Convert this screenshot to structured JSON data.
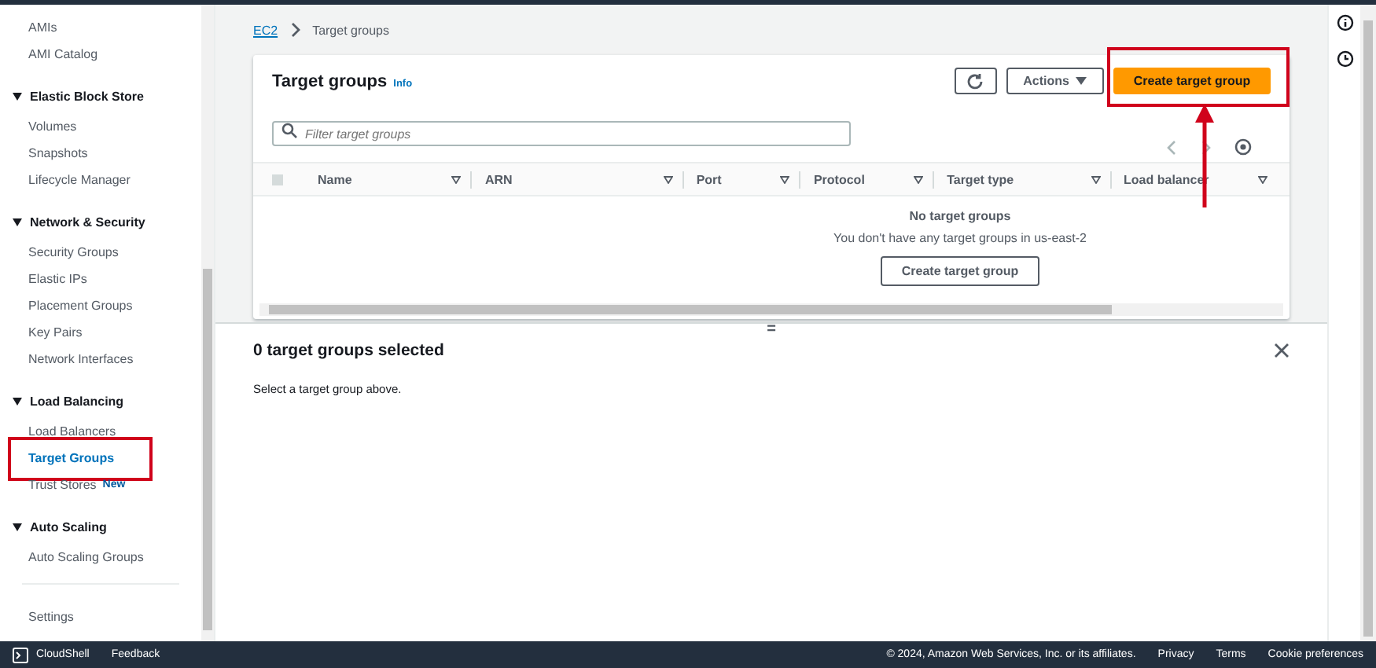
{
  "sidebar": {
    "sections": [
      {
        "items": [
          {
            "label": "AMIs",
            "selected": false
          },
          {
            "label": "AMI Catalog",
            "selected": false
          }
        ]
      },
      {
        "title": "Elastic Block Store",
        "expanded": true,
        "items": [
          {
            "label": "Volumes",
            "selected": false
          },
          {
            "label": "Snapshots",
            "selected": false
          },
          {
            "label": "Lifecycle Manager",
            "selected": false
          }
        ]
      },
      {
        "title": "Network & Security",
        "expanded": true,
        "items": [
          {
            "label": "Security Groups",
            "selected": false
          },
          {
            "label": "Elastic IPs",
            "selected": false
          },
          {
            "label": "Placement Groups",
            "selected": false
          },
          {
            "label": "Key Pairs",
            "selected": false
          },
          {
            "label": "Network Interfaces",
            "selected": false
          }
        ]
      },
      {
        "title": "Load Balancing",
        "expanded": true,
        "items": [
          {
            "label": "Load Balancers",
            "selected": false
          },
          {
            "label": "Target Groups",
            "selected": true,
            "highlighted": true
          },
          {
            "label": "Trust Stores",
            "selected": false,
            "badge": "New"
          }
        ]
      },
      {
        "title": "Auto Scaling",
        "expanded": true,
        "items": [
          {
            "label": "Auto Scaling Groups",
            "selected": false
          }
        ]
      }
    ],
    "footer_items": [
      "Settings"
    ]
  },
  "breadcrumb": [
    "EC2",
    "Target groups"
  ],
  "panel": {
    "title": "Target groups",
    "info": "Info",
    "actions_button": "Actions",
    "create_button": "Create target group",
    "create_highlighted": true,
    "filter": {
      "placeholder": "Filter target groups"
    },
    "select_all_checked": false,
    "columns": [
      "Name",
      "ARN",
      "Port",
      "Protocol",
      "Target type",
      "Load balancer"
    ],
    "empty_title": "No target groups",
    "empty_text": "You don't have any target groups in us-east-2",
    "empty_button": "Create target group"
  },
  "split": {
    "handle": "=",
    "title": "0 target groups selected",
    "text": "Select a target group above."
  },
  "footer": {
    "left": [
      "CloudShell",
      "Feedback"
    ],
    "right": [
      "© 2024, Amazon Web Services, Inc. or its affiliates.",
      "Privacy",
      "Terms",
      "Cookie preferences"
    ]
  }
}
